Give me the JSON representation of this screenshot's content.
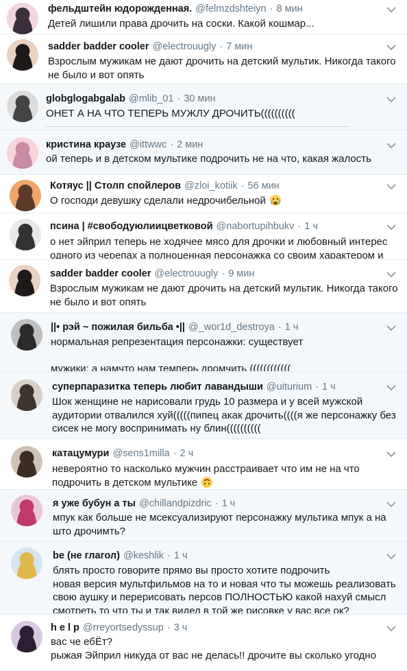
{
  "tweets": [
    {
      "name": "фельдштейн юдорожденная.",
      "handle": "@felmzdshteiyn",
      "dot": "·",
      "time": "8 мин",
      "text": "Детей лишили права дрочить на соски. Какой кошмар..."
    },
    {
      "name": "sadder badder cooler",
      "handle": "@electrouugly",
      "dot": "·",
      "time": "7 мин",
      "text": "Взрослым мужикам не дают дрочить на детский мультик. Никогда такого\nне было и вот опять"
    },
    {
      "name": "globglogabgalab",
      "handle": "@mlib_01",
      "dot": "·",
      "time": "30 мин",
      "text": "ОНЕТ А НА ЧТО ТЕПЕРЬ МУЖЛУ ДРОЧИТЬ(((((((((("
    },
    {
      "name": "кристина краузе",
      "handle": "@ittwwc",
      "dot": "·",
      "time": "2 мин",
      "text": "ой теперь и в детском мультике подрочить не на что, какая жалость"
    },
    {
      "name": "Котяус || Столп спойлеров",
      "handle": "@zloi_kotiik",
      "dot": "·",
      "time": "56 мин",
      "text": "О господи девушку сделали недрочибельной",
      "emoji": "crying-face-icon"
    },
    {
      "name": "псина | #свободуюлиицветковой",
      "handle": "@nabortupihbukv",
      "dot": "·",
      "time": "1 ч",
      "text": "о нет эйприл теперь не ходячее мясо для дрочки и любовный интерес\nодного из черепах а полноценная персонажка со своим характером и"
    },
    {
      "name": "sadder badder cooler",
      "handle": "@electrouugly",
      "dot": "·",
      "time": "9 мин",
      "text": "Взрослым мужикам не дают дрочить на детский мультик. Никогда такого\nне было и вот опять"
    },
    {
      "name": "||• рэй ~ пожилая бильба •||",
      "handle": "@_wor1d_destroya",
      "dot": "·",
      "time": "1 ч",
      "text": "нормальная репрезентация персонажки: существует\n\nмужики: а намчто нам темперь дромчить (((((((((((("
    },
    {
      "name": "суперпаразитка теперь любит лавандыши",
      "handle": "@uiturium",
      "dot": "·",
      "time": "1 ч",
      "text": "Шок женщине не нарисовали грудь 10 размера и у всей мужской\nаудитории отвалился хуй(((((пипец акак дрочить((((я же персонажку без\nсисек не могу воспринимать ну блин(((((((((("
    },
    {
      "name": "катацумури",
      "handle": "@sens1milla",
      "dot": "·",
      "time": "2 ч",
      "text": "невероятно то насколько мужчин расстраивает что им не на что\nподрочить в детском мультике",
      "emoji": "upside-down-face-icon"
    },
    {
      "name": "я уже бубун а ты",
      "handle": "@chillandpizdric",
      "dot": "·",
      "time": "1 ч",
      "text": "мпук как больше не мсексуализируют персонажку мультика мпук а на\nшто дрочимть?"
    },
    {
      "name": "be (не глагол)",
      "handle": "@keshlik",
      "dot": "·",
      "time": "1 ч",
      "text": "блять просто говорите прямо вы просто хотите подрочить\nновая версия мультфильмов на то и новая что ты можешь реализовать\nсвою аушку и перерисовать перс ов ПОЛНОСТЬЮ какой нахуй смысл\nсмотреть то что ты и так видел в той же рисовке у вас все ок?"
    },
    {
      "name": "h e l p",
      "handle": "@rreyortsedyssup",
      "dot": "·",
      "time": "3 ч",
      "text": "вас че ебЁт?\nрыжая Эйприл никуда от вас не делась!! дрочите вы сколько угодно"
    }
  ],
  "colors": {
    "name": "#14171a",
    "meta": "#657786",
    "border": "#e6ecf0",
    "tint": "#f5f8fa"
  },
  "icons": {
    "caret": "chevron-down-icon"
  }
}
